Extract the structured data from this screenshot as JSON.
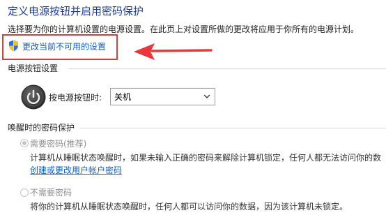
{
  "header": {
    "title": "定义电源按钮并启用密码保护",
    "subtitle": "选择要为你的计算机设置的电源设置。在此页上对设置所做的更改将应用于你所有的电源计划。"
  },
  "change_settings": {
    "label": "更改当前不可用的设置",
    "icon": "uac-shield-icon",
    "highlight_color": "#e8383b"
  },
  "power_button_section": {
    "title": "电源按钮设置",
    "label": "按电源按钮时:",
    "selected": "关机"
  },
  "wake_section": {
    "title": "唤醒时的密码保护",
    "options": [
      {
        "label": "需要密码(推荐)",
        "checked": true,
        "description": "计算机从睡眠状态唤醒时，如果未输入正确的密码来解除计算机锁定，任何人都无法访问你的数",
        "link": "创建或更改用户帐户密码"
      },
      {
        "label": "不需要密码",
        "checked": false,
        "description": "将你的计算机从睡眠状态唤醒时，任何人都可以访问你的数据，因为该计算机未锁定。"
      }
    ]
  },
  "colors": {
    "title": "#1f3f95",
    "link": "#0b5ec6",
    "annotation": "#e8383b"
  }
}
